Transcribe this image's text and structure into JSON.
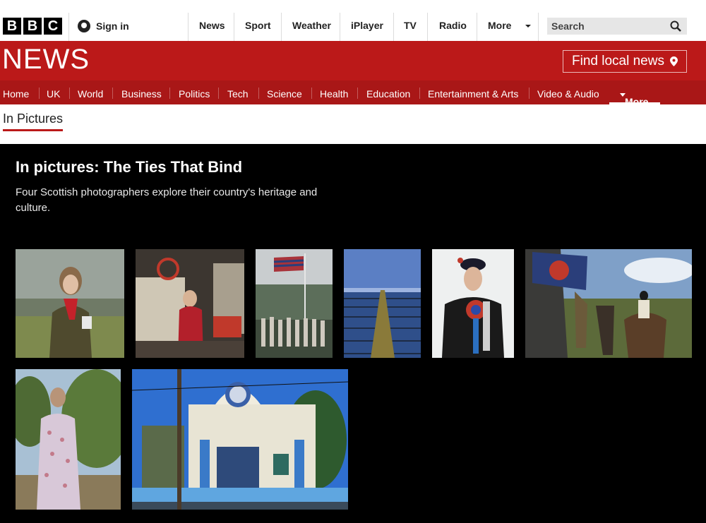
{
  "topbar": {
    "logo_letters": [
      "B",
      "B",
      "C"
    ],
    "signin_label": "Sign in",
    "nav": [
      "News",
      "Sport",
      "Weather",
      "iPlayer",
      "TV",
      "Radio",
      "More"
    ],
    "search_placeholder": "Search"
  },
  "newsband": {
    "logo": "NEWS",
    "find_local": "Find local news"
  },
  "subnav": {
    "items": [
      "Home",
      "UK",
      "World",
      "Business",
      "Politics",
      "Tech",
      "Science",
      "Health",
      "Education",
      "Entertainment & Arts",
      "Video & Audio"
    ],
    "more_label": "More"
  },
  "section_title": "In Pictures",
  "article": {
    "headline": "In pictures: The Ties That Bind",
    "standfirst": "Four Scottish photographers explore their country's heritage and culture."
  },
  "icons": [
    "person-icon",
    "chevron-down-icon",
    "search-icon",
    "location-pin-icon"
  ],
  "colors": {
    "brand_red": "#bb1919",
    "subnav_red": "#a91717",
    "main_bg": "#000000"
  }
}
